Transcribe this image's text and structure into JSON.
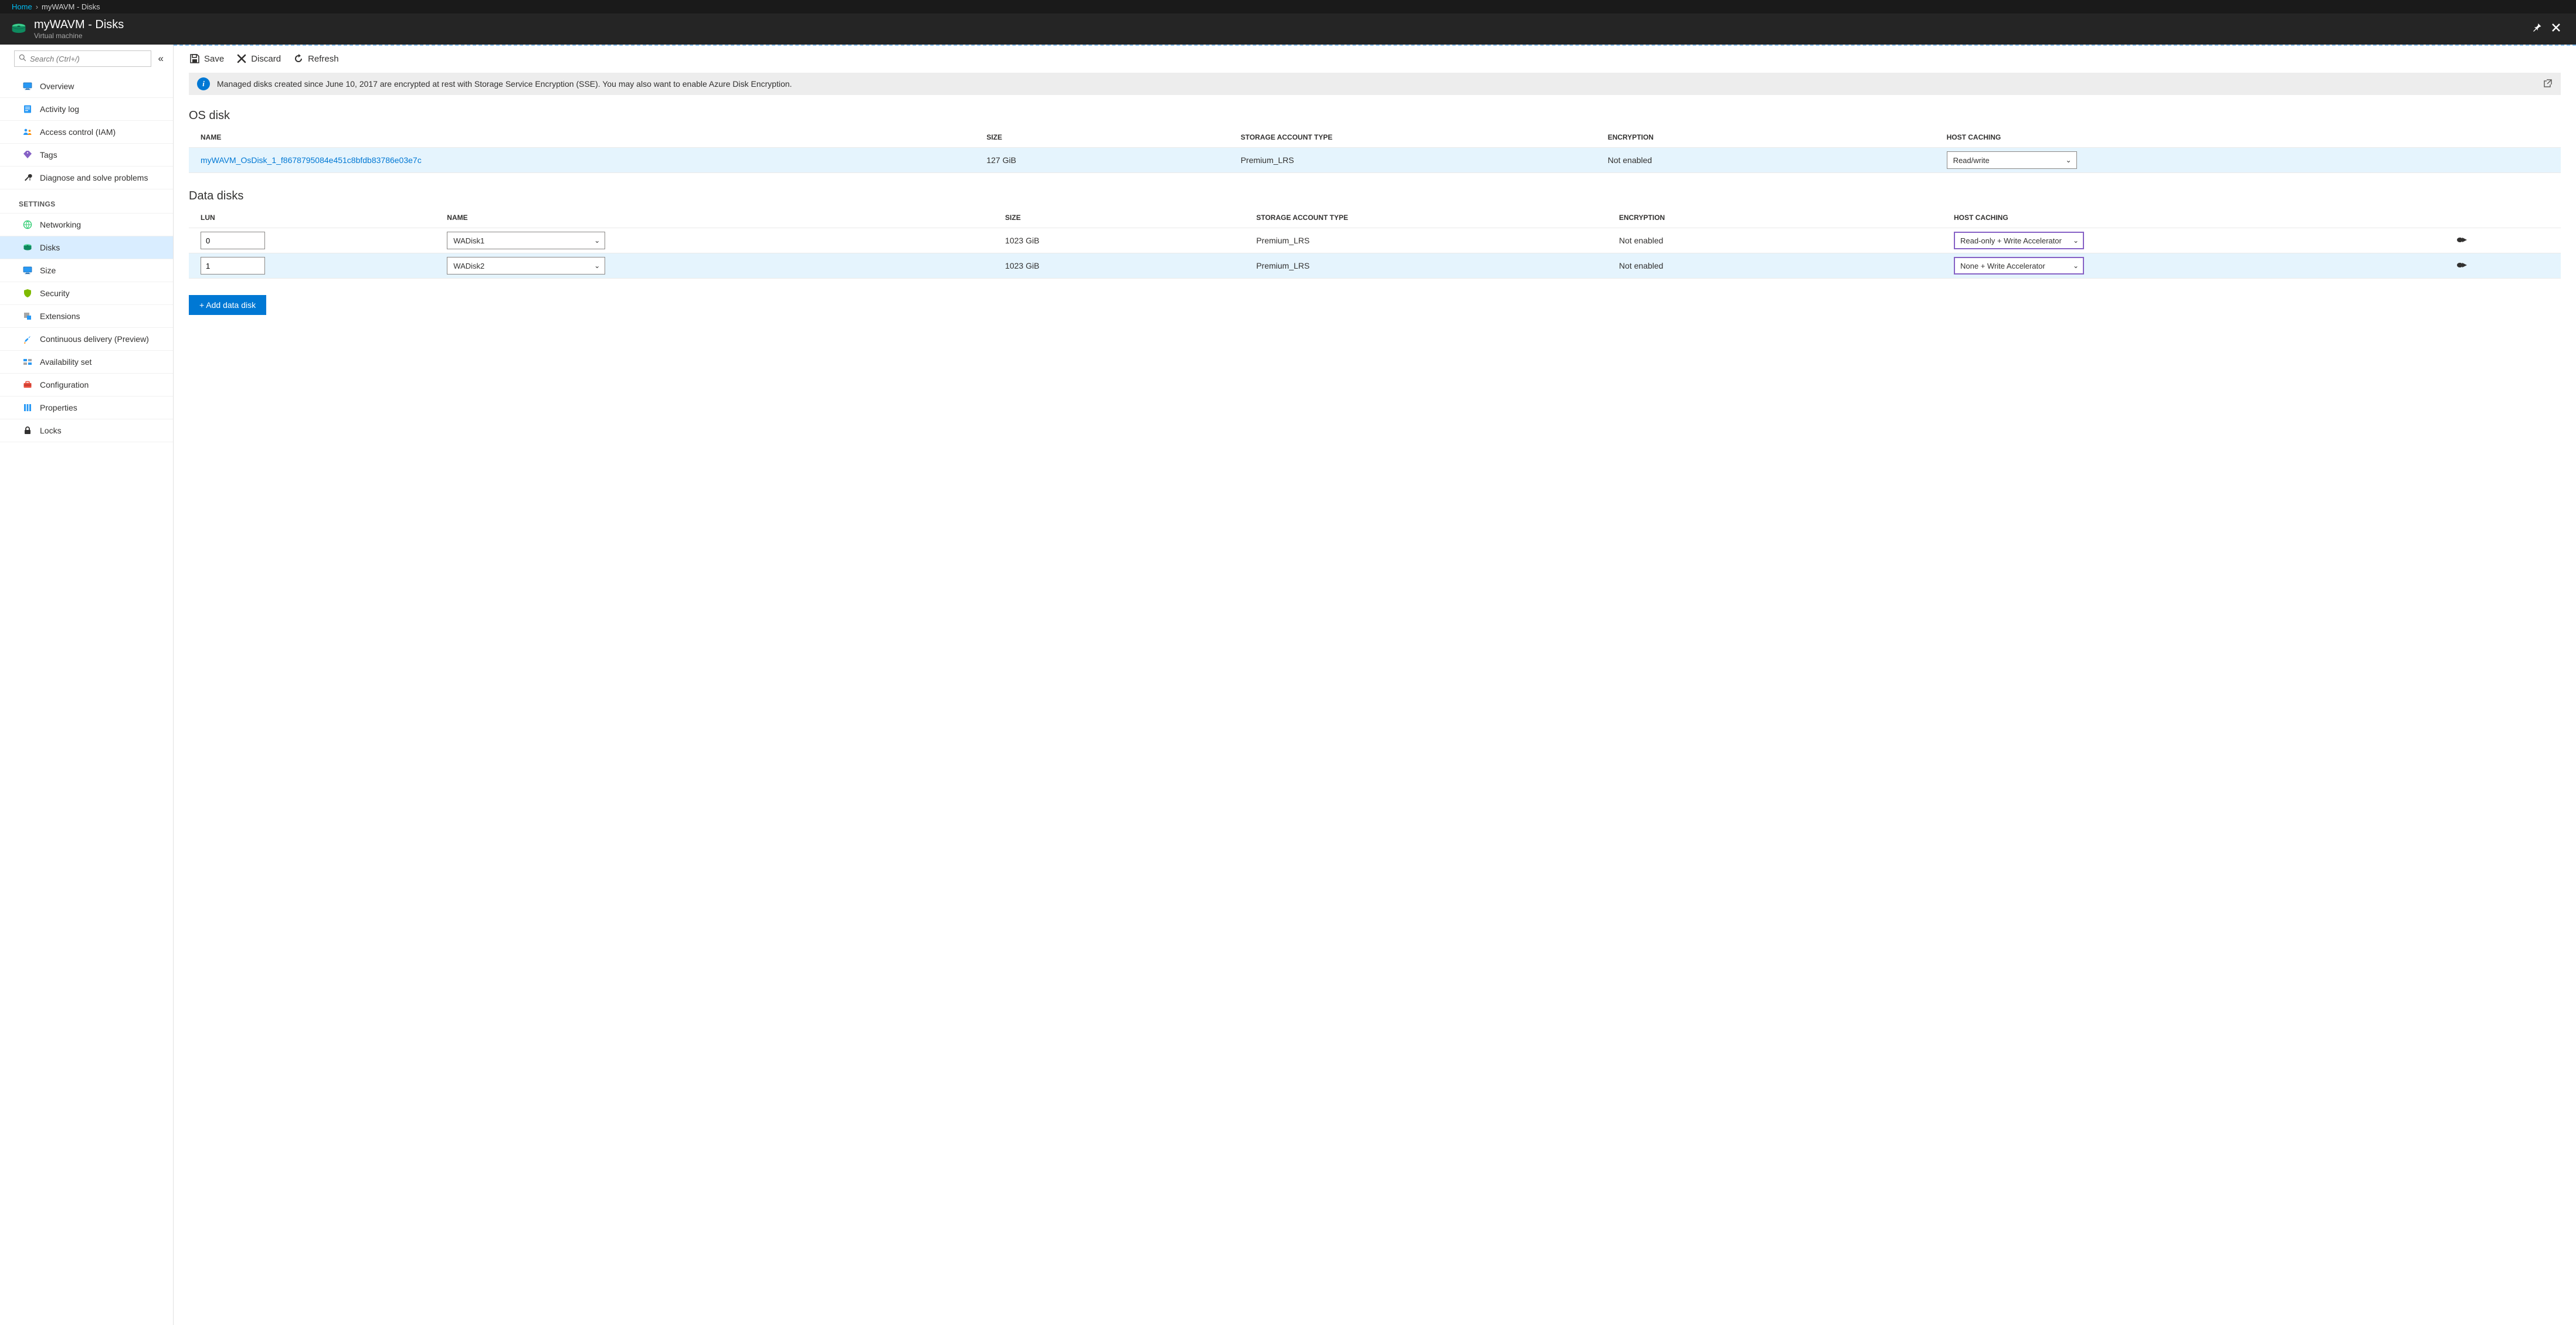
{
  "breadcrumb": {
    "home": "Home",
    "current": "myWAVM - Disks"
  },
  "header": {
    "title": "myWAVM - Disks",
    "subtitle": "Virtual machine"
  },
  "search": {
    "placeholder": "Search (Ctrl+/)"
  },
  "sidebar": {
    "items_top": [
      {
        "label": "Overview",
        "icon": "monitor"
      },
      {
        "label": "Activity log",
        "icon": "log"
      },
      {
        "label": "Access control (IAM)",
        "icon": "iam"
      },
      {
        "label": "Tags",
        "icon": "tag"
      },
      {
        "label": "Diagnose and solve problems",
        "icon": "wrench"
      }
    ],
    "section_settings": "SETTINGS",
    "items_settings": [
      {
        "label": "Networking",
        "icon": "network"
      },
      {
        "label": "Disks",
        "icon": "disks",
        "selected": true
      },
      {
        "label": "Size",
        "icon": "size"
      },
      {
        "label": "Security",
        "icon": "shield"
      },
      {
        "label": "Extensions",
        "icon": "ext"
      },
      {
        "label": "Continuous delivery (Preview)",
        "icon": "cd"
      },
      {
        "label": "Availability set",
        "icon": "avail"
      },
      {
        "label": "Configuration",
        "icon": "config"
      },
      {
        "label": "Properties",
        "icon": "props"
      },
      {
        "label": "Locks",
        "icon": "lock"
      }
    ]
  },
  "toolbar": {
    "save": "Save",
    "discard": "Discard",
    "refresh": "Refresh"
  },
  "banner": {
    "msg": "Managed disks created since June 10, 2017 are encrypted at rest with Storage Service Encryption (SSE). You may also want to enable Azure Disk Encryption."
  },
  "os_section": {
    "title": "OS disk",
    "cols": {
      "name": "NAME",
      "size": "SIZE",
      "sat": "STORAGE ACCOUNT TYPE",
      "enc": "ENCRYPTION",
      "hc": "HOST CACHING"
    },
    "row": {
      "name": "myWAVM_OsDisk_1_f8678795084e451c8bfdb83786e03e7c",
      "size": "127 GiB",
      "sat": "Premium_LRS",
      "enc": "Not enabled",
      "hc": "Read/write"
    }
  },
  "data_section": {
    "title": "Data disks",
    "cols": {
      "lun": "LUN",
      "name": "NAME",
      "size": "SIZE",
      "sat": "STORAGE ACCOUNT TYPE",
      "enc": "ENCRYPTION",
      "hc": "HOST CACHING"
    },
    "rows": [
      {
        "lun": "0",
        "name": "WADisk1",
        "size": "1023 GiB",
        "sat": "Premium_LRS",
        "enc": "Not enabled",
        "hc": "Read-only + Write Accelerator"
      },
      {
        "lun": "1",
        "name": "WADisk2",
        "size": "1023 GiB",
        "sat": "Premium_LRS",
        "enc": "Not enabled",
        "hc": "None + Write Accelerator"
      }
    ],
    "add_button": "+ Add data disk"
  }
}
